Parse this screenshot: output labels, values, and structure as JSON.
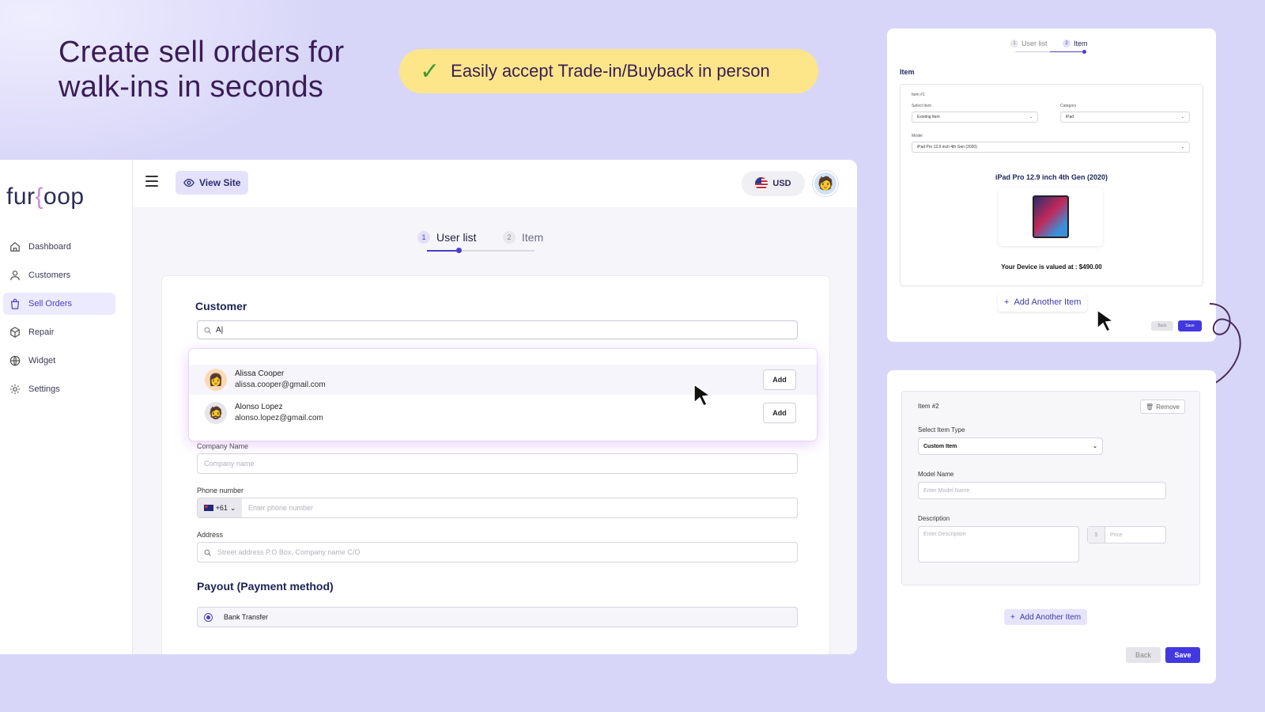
{
  "hero": {
    "headline": "Create sell orders for walk-ins in seconds",
    "pill_check": "✓",
    "pill_text": "Easily accept Trade-in/Buyback in person"
  },
  "sidebar": {
    "logo_left": "fur",
    "logo_brace": "{",
    "logo_right": "oop",
    "items": [
      {
        "label": "Dashboard",
        "icon": "home-icon"
      },
      {
        "label": "Customers",
        "icon": "user-icon"
      },
      {
        "label": "Sell Orders",
        "icon": "bag-icon",
        "active": true
      },
      {
        "label": "Repair",
        "icon": "box-icon"
      },
      {
        "label": "Widget",
        "icon": "globe-icon"
      },
      {
        "label": "Settings",
        "icon": "gear-icon"
      }
    ]
  },
  "topbar": {
    "view_site": "View Site",
    "currency": "USD"
  },
  "stepper": {
    "step1_num": "1",
    "step1_label": "User list",
    "step2_num": "2",
    "step2_label": "Item"
  },
  "customer": {
    "title": "Customer",
    "search_value": "A|",
    "results": [
      {
        "name": "Alissa Cooper",
        "email": "alissa.cooper@gmail.com",
        "add": "Add"
      },
      {
        "name": "Alonso Lopez",
        "email": "alonso.lopez@gmail.com",
        "add": "Add"
      }
    ],
    "company_label": "Company Name",
    "company_placeholder": "Company name",
    "phone_label": "Phone number",
    "phone_prefix": "+61",
    "phone_placeholder": "Enter phone number",
    "address_label": "Address",
    "address_placeholder": "Street address P.O Box, Company name C/O"
  },
  "payout": {
    "title": "Payout (Payment method)",
    "option": "Bank Transfer"
  },
  "panel_item": {
    "step1": "User list",
    "step2": "Item",
    "step1_num": "1",
    "step2_num": "2",
    "title": "Item",
    "item_no": "Item #1",
    "select_item_label": "Select Item",
    "select_item_value": "Existing Item",
    "category_label": "Category",
    "category_value": "iPad",
    "model_label": "Model",
    "model_value": "iPad Pro 12.9 inch 4th Gen (2020)",
    "product_title": "iPad Pro 12.9 inch 4th Gen (2020)",
    "valued_text": "Your Device is valued at : $490.00",
    "add_another": "Add Another Item",
    "back": "Back",
    "save": "Save"
  },
  "panel_custom": {
    "item_no": "Item #2",
    "remove": "Remove",
    "type_label": "Select Item Type",
    "type_value": "Custom Item",
    "model_label": "Model Name",
    "model_placeholder": "Enter Model Name",
    "desc_label": "Description",
    "desc_placeholder": "Enter Description",
    "currency_symbol": "$",
    "price_placeholder": "Price",
    "add_another": "Add Another Item",
    "back": "Back",
    "save": "Save"
  },
  "colors": {
    "background": "#d8d6f8",
    "accent": "#4b3fc6",
    "pill": "#fde68a",
    "headline": "#3a1d55"
  }
}
